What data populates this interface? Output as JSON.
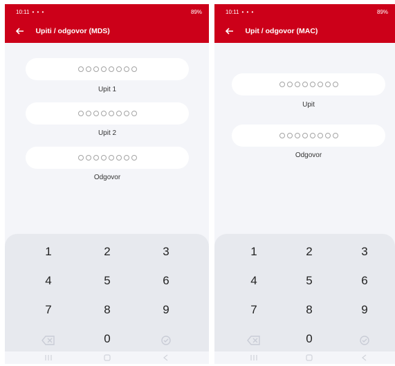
{
  "left_screen": {
    "status_time": "10:11",
    "status_icons": "• • •",
    "status_right": "89%",
    "title": "Upiti / odgovor (MDS)",
    "fields": [
      {
        "label": "Upit 1"
      },
      {
        "label": "Upit 2"
      },
      {
        "label": "Odgovor"
      }
    ]
  },
  "right_screen": {
    "status_time": "10:11",
    "status_icons": "• • •",
    "status_right": "89%",
    "title": "Upit / odgovor (MAC)",
    "fields": [
      {
        "label": "Upit"
      },
      {
        "label": "Odgovor"
      }
    ]
  },
  "keypad": {
    "keys": [
      "1",
      "2",
      "3",
      "4",
      "5",
      "6",
      "7",
      "8",
      "9",
      "0"
    ],
    "backspace_icon": "backspace-icon",
    "confirm_icon": "check-circle-icon"
  },
  "pin": {
    "length": 8
  },
  "colors": {
    "header": "#cc0019",
    "background": "#f4f5f9",
    "keypad": "#e7e9ee"
  }
}
